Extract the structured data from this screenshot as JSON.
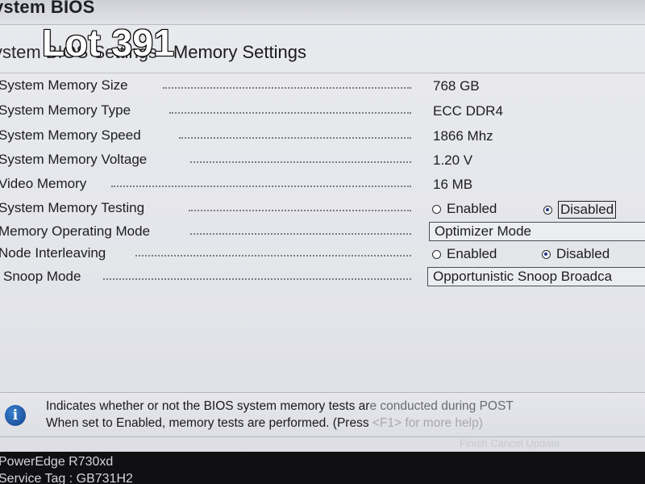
{
  "window": {
    "title": "ystem BIOS",
    "breadcrumb_prefix": "ystem BIOS Settings",
    "breadcrumb_page": "Memory Settings"
  },
  "overlay": {
    "lot_text": "Lot 391"
  },
  "settings": [
    {
      "label": "System Memory Size",
      "value": "768 GB"
    },
    {
      "label": "System Memory Type",
      "value": "ECC DDR4"
    },
    {
      "label": "System Memory Speed",
      "value": "1866 Mhz"
    },
    {
      "label": "System Memory Voltage",
      "value": "1.20 V"
    },
    {
      "label": "Video Memory",
      "value": "16 MB"
    },
    {
      "label": "System Memory Testing",
      "options": [
        "Enabled",
        "Disabled"
      ],
      "selected": "Disabled"
    },
    {
      "label": "Memory Operating Mode",
      "value": "Optimizer Mode"
    },
    {
      "label": "Node Interleaving",
      "options": [
        "Enabled",
        "Disabled"
      ],
      "selected": "Disabled"
    },
    {
      "label": "Snoop Mode",
      "value": "Opportunistic Snoop Broadca"
    }
  ],
  "help": {
    "line1_a": "Indicates whether or not the BIOS system memory tests ar",
    "line1_b": "e conducted during POST",
    "line2_a": "When set to Enabled, memory tests are performed. (Press ",
    "line2_b": "<F1> for more help)",
    "ghost": "Finish Cancel Update"
  },
  "footer": {
    "model": "PowerEdge R730xd",
    "service_tag": "Service Tag : GB731H2"
  }
}
